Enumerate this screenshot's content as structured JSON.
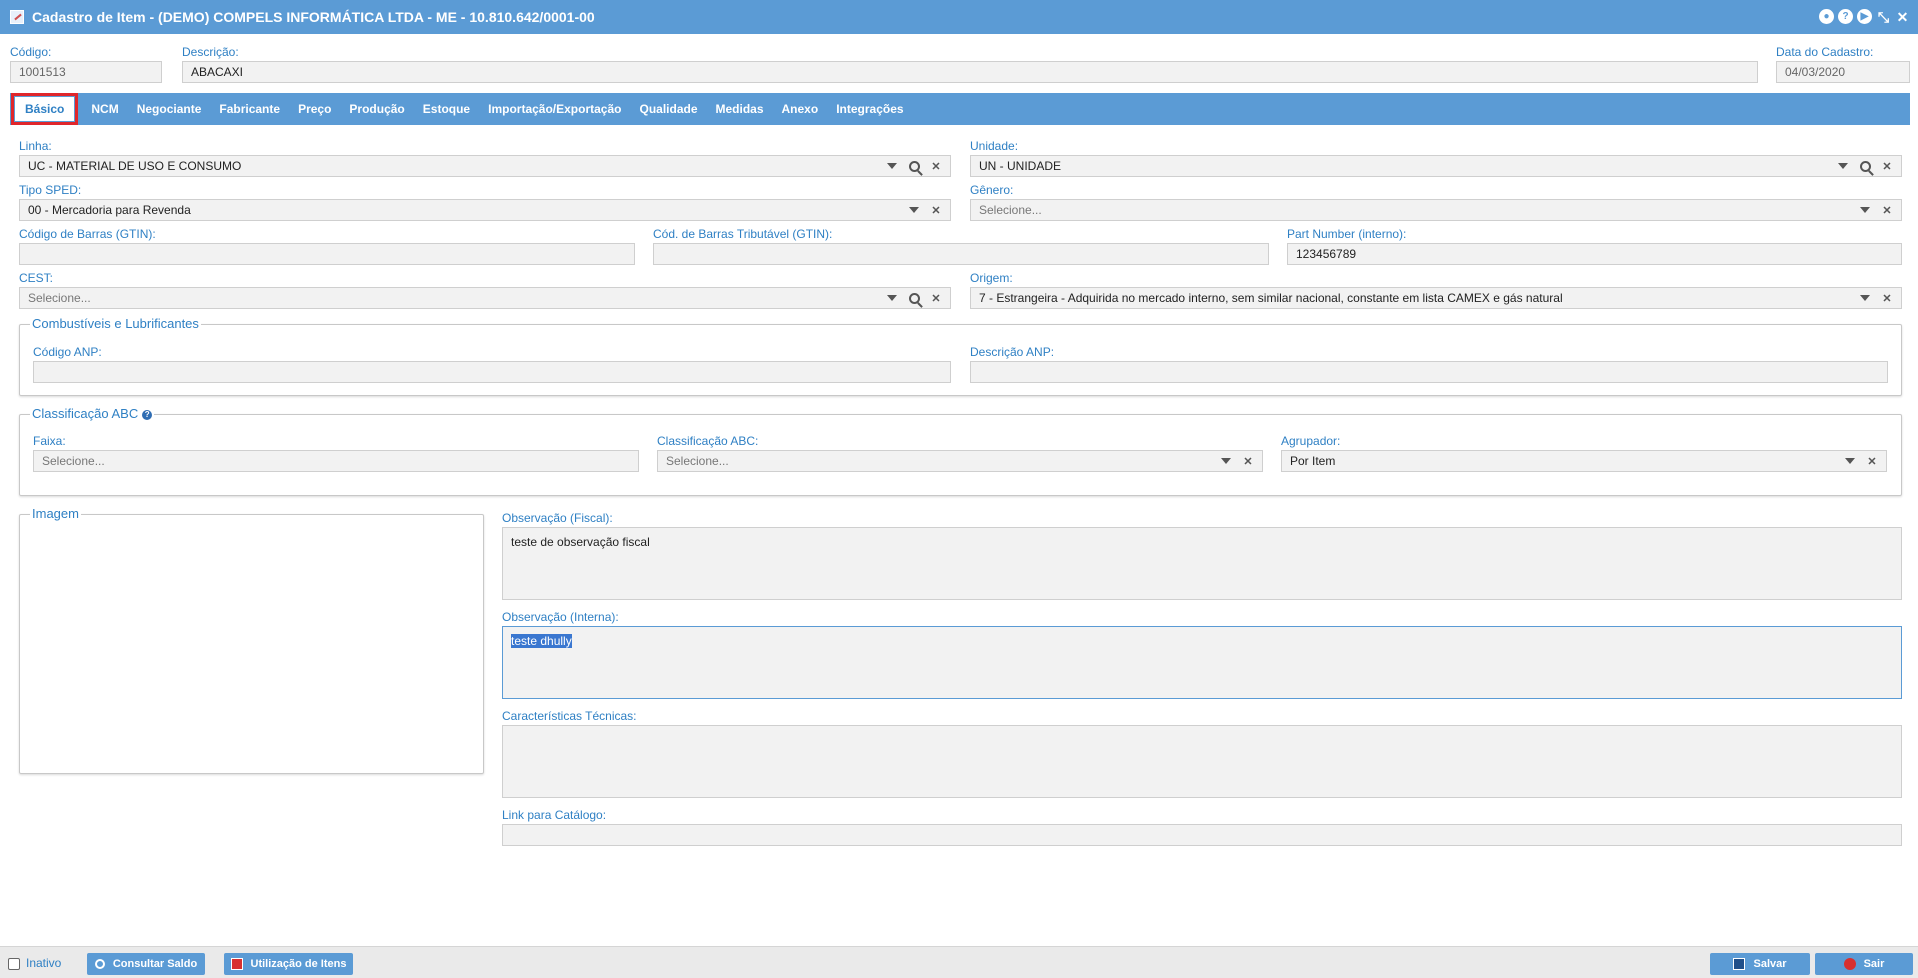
{
  "window": {
    "title": "Cadastro de Item - (DEMO) COMPELS INFORMÁTICA LTDA - ME - 10.810.642/0001-00"
  },
  "header": {
    "codigo_label": "Código:",
    "codigo_value": "1001513",
    "descricao_label": "Descrição:",
    "descricao_value": "ABACAXI",
    "data_label": "Data do Cadastro:",
    "data_value": "04/03/2020"
  },
  "tabs": [
    {
      "label": "Básico",
      "active": true
    },
    {
      "label": "NCM"
    },
    {
      "label": "Negociante"
    },
    {
      "label": "Fabricante"
    },
    {
      "label": "Preço"
    },
    {
      "label": "Produção"
    },
    {
      "label": "Estoque"
    },
    {
      "label": "Importação/Exportação"
    },
    {
      "label": "Qualidade"
    },
    {
      "label": "Medidas"
    },
    {
      "label": "Anexo"
    },
    {
      "label": "Integrações"
    }
  ],
  "basic": {
    "linha_label": "Linha:",
    "linha_value": "UC - MATERIAL DE USO E CONSUMO",
    "unidade_label": "Unidade:",
    "unidade_value": "UN - UNIDADE",
    "tipo_sped_label": "Tipo SPED:",
    "tipo_sped_value": "00 - Mercadoria para Revenda",
    "genero_label": "Gênero:",
    "genero_placeholder": "Selecione...",
    "gtin_label": "Código de Barras (GTIN):",
    "gtin_value": "",
    "gtin_trib_label": "Cód. de Barras Tributável (GTIN):",
    "gtin_trib_value": "",
    "part_number_label": "Part Number (interno):",
    "part_number_value": "123456789",
    "cest_label": "CEST:",
    "cest_placeholder": "Selecione...",
    "origem_label": "Origem:",
    "origem_value": "7 - Estrangeira - Adquirida no mercado interno, sem similar nacional, constante em lista CAMEX e gás natural"
  },
  "combustiveis": {
    "legend": "Combustíveis e Lubrificantes",
    "codigo_anp_label": "Código ANP:",
    "descricao_anp_label": "Descrição ANP:"
  },
  "abc": {
    "legend": "Classificação ABC",
    "faixa_label": "Faixa:",
    "faixa_placeholder": "Selecione...",
    "classificacao_label": "Classificação ABC:",
    "classificacao_placeholder": "Selecione...",
    "agrupador_label": "Agrupador:",
    "agrupador_value": "Por Item"
  },
  "imagem": {
    "legend": "Imagem"
  },
  "obs": {
    "fiscal_label": "Observação (Fiscal):",
    "fiscal_value": "teste de observação fiscal",
    "interna_label": "Observação (Interna):",
    "interna_value": "teste dhully",
    "tecnicas_label": "Características Técnicas:",
    "link_label": "Link para Catálogo:"
  },
  "footer": {
    "inativo_label": "Inativo",
    "consultar_label": "Consultar Saldo",
    "utilizacao_label": "Utilização de Itens",
    "salvar_label": "Salvar",
    "sair_label": "Sair"
  },
  "colors": {
    "accent": "#5b9bd5",
    "label": "#2f80c4",
    "active_tab_outline": "#e0262b"
  }
}
